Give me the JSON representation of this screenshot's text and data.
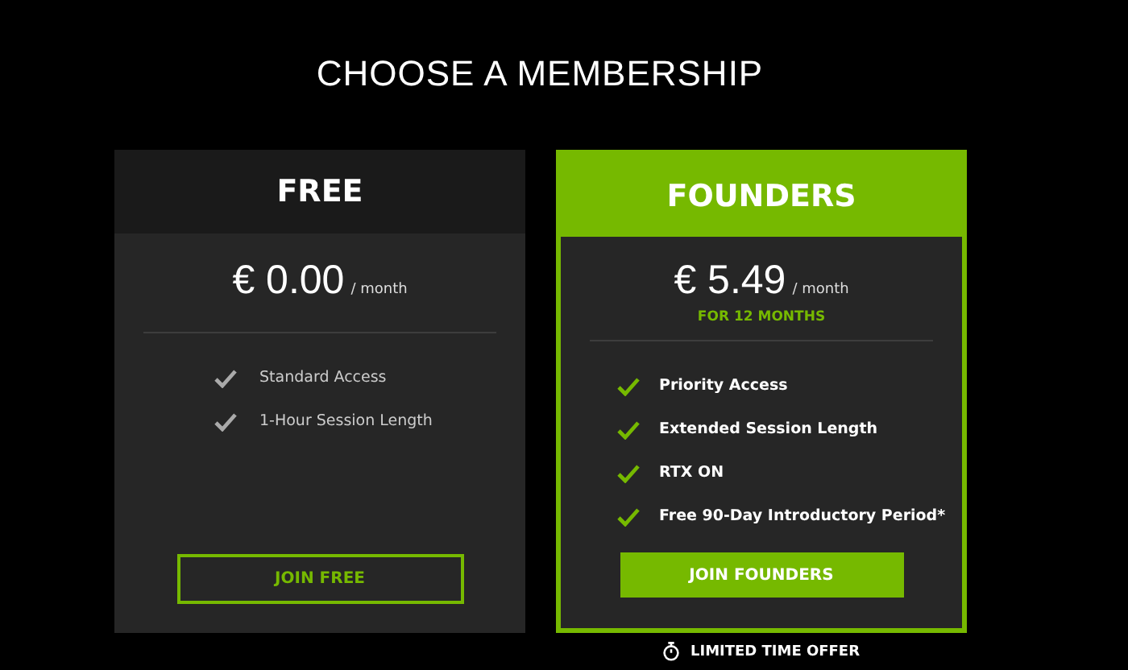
{
  "title": "CHOOSE A MEMBERSHIP",
  "plans": [
    {
      "name": "FREE",
      "featured": false,
      "currency": "€",
      "price": "0.00",
      "period": "/ month",
      "features": [
        "Standard Access",
        "1-Hour Session Length"
      ],
      "button": "JOIN FREE"
    },
    {
      "name": "FOUNDERS",
      "featured": true,
      "currency": "€",
      "price": "5.49",
      "period": "/ month",
      "term": "FOR 12 MONTHS",
      "features": [
        "Priority Access",
        "Extended Session Length",
        "RTX ON",
        "Free 90-Day Introductory Period*"
      ],
      "button": "JOIN FOUNDERS",
      "note": "LIMITED TIME OFFER"
    }
  ]
}
